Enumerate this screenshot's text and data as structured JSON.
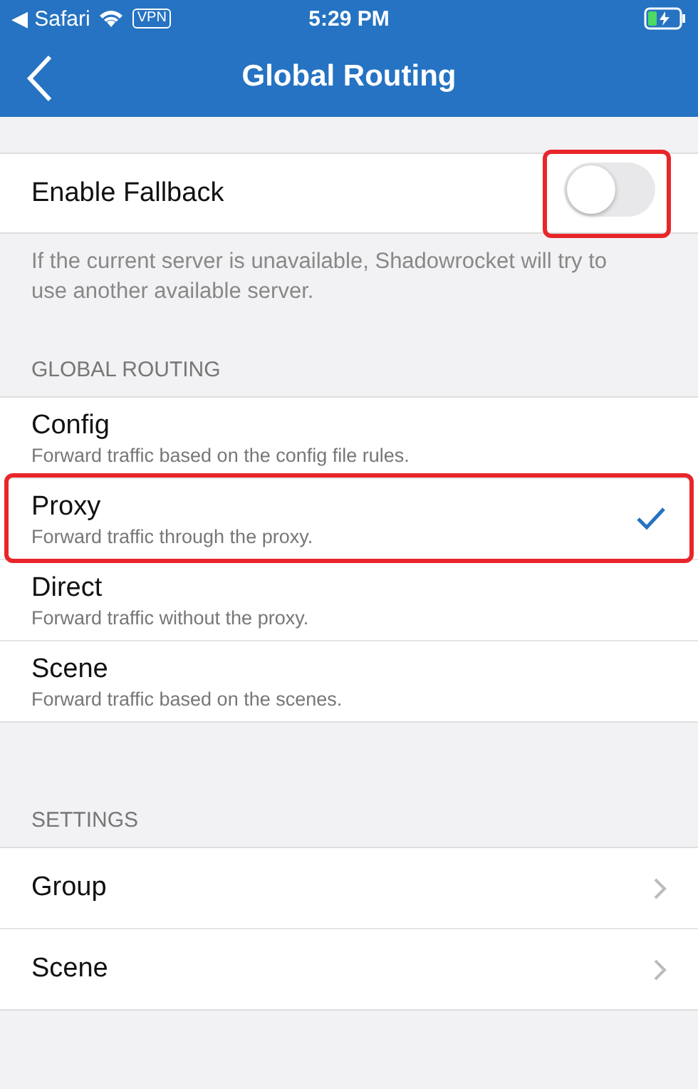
{
  "status_bar": {
    "back_app": "◀ Safari",
    "vpn": "VPN",
    "time": "5:29 PM"
  },
  "nav": {
    "title": "Global Routing"
  },
  "fallback": {
    "label": "Enable Fallback",
    "on": false,
    "highlighted": true,
    "footer": "If the current server is unavailable, Shadowrocket will try to use another available server."
  },
  "routing": {
    "header": "GLOBAL ROUTING",
    "items": [
      {
        "title": "Config",
        "subtitle": "Forward traffic based on the config file rules.",
        "selected": false,
        "highlighted": false
      },
      {
        "title": "Proxy",
        "subtitle": "Forward traffic through the proxy.",
        "selected": true,
        "highlighted": true
      },
      {
        "title": "Direct",
        "subtitle": "Forward traffic without the proxy.",
        "selected": false,
        "highlighted": false
      },
      {
        "title": "Scene",
        "subtitle": "Forward traffic based on the scenes.",
        "selected": false,
        "highlighted": false
      }
    ]
  },
  "settings": {
    "header": "SETTINGS",
    "items": [
      {
        "label": "Group"
      },
      {
        "label": "Scene"
      }
    ]
  }
}
